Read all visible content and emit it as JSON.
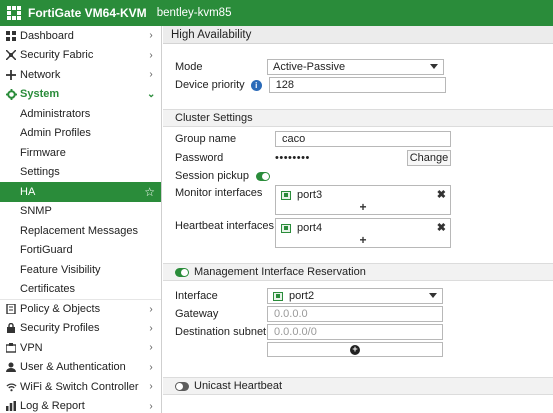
{
  "topbar": {
    "title": "FortiGate VM64-KVM",
    "hostname": "bentley-kvm85"
  },
  "sidebar": {
    "items": [
      {
        "label": "Dashboard",
        "icon": "dashboard-icon",
        "chevron": "›"
      },
      {
        "label": "Security Fabric",
        "icon": "security-fabric-icon",
        "chevron": "›"
      },
      {
        "label": "Network",
        "icon": "network-icon",
        "chevron": "›"
      },
      {
        "label": "System",
        "icon": "gear-icon",
        "chevron": "⌄"
      },
      {
        "label": "Administrators"
      },
      {
        "label": "Admin Profiles"
      },
      {
        "label": "Firmware"
      },
      {
        "label": "Settings"
      },
      {
        "label": "HA",
        "favorite_icon": "☆"
      },
      {
        "label": "SNMP"
      },
      {
        "label": "Replacement Messages"
      },
      {
        "label": "FortiGuard"
      },
      {
        "label": "Feature Visibility"
      },
      {
        "label": "Certificates"
      },
      {
        "label": "Policy & Objects",
        "icon": "policy-icon",
        "chevron": "›"
      },
      {
        "label": "Security Profiles",
        "icon": "lock-icon",
        "chevron": "›"
      },
      {
        "label": "VPN",
        "icon": "vpn-icon",
        "chevron": "›"
      },
      {
        "label": "User & Authentication",
        "icon": "user-icon",
        "chevron": "›"
      },
      {
        "label": "WiFi & Switch Controller",
        "icon": "wifi-icon",
        "chevron": "›"
      },
      {
        "label": "Log & Report",
        "icon": "log-icon",
        "chevron": "›"
      }
    ]
  },
  "main": {
    "page_title": "High Availability",
    "mode": {
      "label": "Mode",
      "value": "Active-Passive"
    },
    "device_priority": {
      "label": "Device priority",
      "value": "128"
    },
    "cluster": {
      "section_title": "Cluster Settings",
      "group_name": {
        "label": "Group name",
        "value": "caco"
      },
      "password": {
        "label": "Password",
        "value": "••••••••",
        "change_label": "Change"
      },
      "session_pickup": {
        "label": "Session pickup",
        "enabled": true
      },
      "monitor_interfaces": {
        "label": "Monitor interfaces",
        "port": "port3",
        "add": "+",
        "remove": "✖"
      },
      "heartbeat_interfaces": {
        "label": "Heartbeat interfaces",
        "port": "port4",
        "add": "+",
        "remove": "✖"
      }
    },
    "mgmt": {
      "section_title": "Management Interface Reservation",
      "enabled": true,
      "interface": {
        "label": "Interface",
        "value": "port2"
      },
      "gateway": {
        "label": "Gateway",
        "placeholder": "0.0.0.0"
      },
      "destination_subnet": {
        "label": "Destination subnet",
        "placeholder": "0.0.0.0/0"
      },
      "add": "+"
    },
    "unicast": {
      "section_title": "Unicast Heartbeat",
      "enabled": false
    }
  },
  "colors": {
    "brand": "#2a8c3a",
    "info": "#2a6ab8"
  }
}
